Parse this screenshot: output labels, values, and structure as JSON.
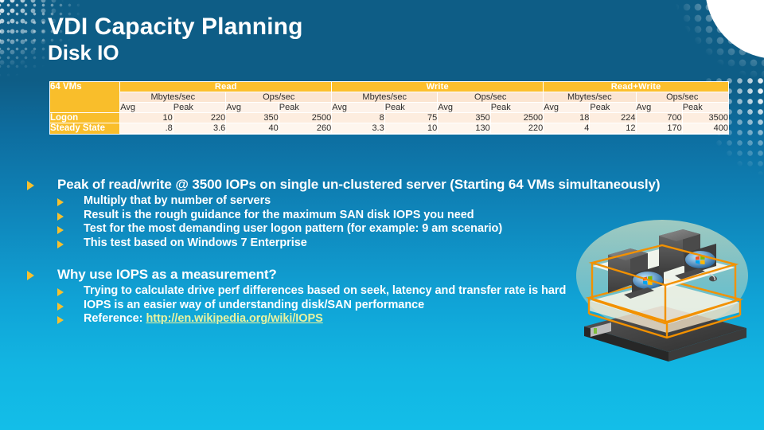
{
  "slide": {
    "title": "VDI Capacity Planning",
    "subtitle": "Disk IO",
    "accent_gold": "#F9BE2B",
    "accent_blue": "#0e5d86",
    "link_color": "#E9F3A0"
  },
  "table": {
    "corner_label": "64 VMs",
    "groups": [
      "Read",
      "Write",
      "Read+Write"
    ],
    "units": [
      "Mbytes/sec",
      "Ops/sec",
      "Mbytes/sec",
      "Ops/sec",
      "Mbytes/sec",
      "Ops/sec"
    ],
    "subheaders": [
      "Avg",
      "Peak",
      "Avg",
      "Peak",
      "Avg",
      "Peak",
      "Avg",
      "Peak",
      "Avg",
      "Peak",
      "Avg",
      "Peak"
    ],
    "rows": [
      {
        "label": "Logon",
        "values": [
          "10",
          "220",
          "350",
          "2500",
          "8",
          "75",
          "350",
          "2500",
          "18",
          "224",
          "700",
          "3500"
        ]
      },
      {
        "label": "Steady State",
        "values": [
          ".8",
          "3.6",
          "40",
          "260",
          "3.3",
          "10",
          "130",
          "220",
          "4",
          "12",
          "170",
          "400"
        ]
      }
    ]
  },
  "chart_data": {
    "type": "table",
    "title": "VDI Capacity Planning – Disk IO (64 VMs)",
    "categories": [
      "Logon",
      "Steady State"
    ],
    "columns": [
      "Read Mbytes/sec Avg",
      "Read Mbytes/sec Peak",
      "Read Ops/sec Avg",
      "Read Ops/sec Peak",
      "Write Mbytes/sec Avg",
      "Write Mbytes/sec Peak",
      "Write Ops/sec Avg",
      "Write Ops/sec Peak",
      "Read+Write Mbytes/sec Avg",
      "Read+Write Mbytes/sec Peak",
      "Read+Write Ops/sec Avg",
      "Read+Write Ops/sec Peak"
    ],
    "series": [
      {
        "name": "Logon",
        "values": [
          10,
          220,
          350,
          2500,
          8,
          75,
          350,
          2500,
          18,
          224,
          700,
          3500
        ]
      },
      {
        "name": "Steady State",
        "values": [
          0.8,
          3.6,
          40,
          260,
          3.3,
          10,
          130,
          220,
          4,
          12,
          170,
          400
        ]
      }
    ]
  },
  "content": {
    "b1": "Peak of read/write @ 3500 IOPs on single un-clustered server (Starting 64 VMs simultaneously)",
    "b1a": "Multiply that by number of servers",
    "b1b": "Result is the rough guidance for the maximum SAN disk IOPS you need",
    "b1c": "Test for the most demanding user logon pattern (for example: 9 am scenario)",
    "b1d": "This test based on Windows 7 Enterprise",
    "b2": "Why use IOPS as a measurement?",
    "b2a": "Trying to calculate drive perf differences based on seek, latency and transfer rate is hard",
    "b2b": "IOPS is an easier way of understanding disk/SAN performance",
    "b2c_prefix": "Reference: ",
    "b2c_link": "http://en.wikipedia.org/wiki/IOPS"
  },
  "illustration": {
    "name": "virtual-machines-on-server",
    "caption": "Two virtualized desktop PCs with Windows logo monitors inside orange wireframe boxes stacked on a rack server"
  }
}
